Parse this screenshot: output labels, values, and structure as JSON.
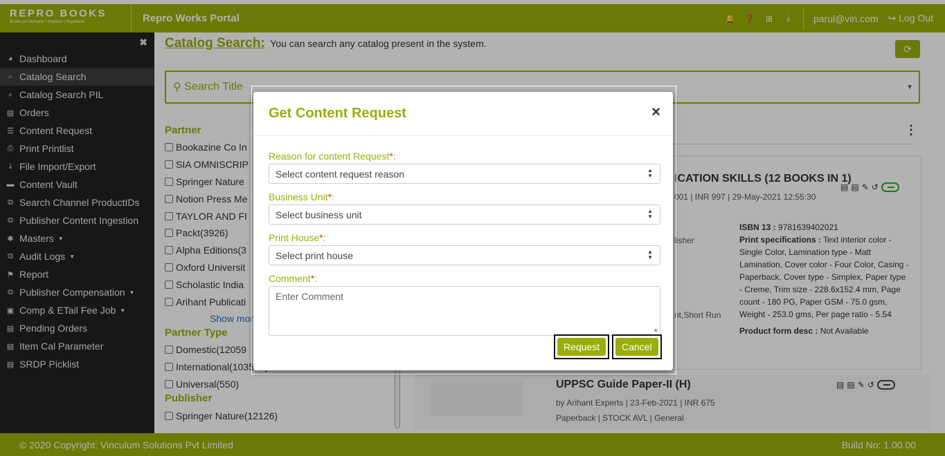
{
  "header": {
    "logo": "REPRO BOOKS",
    "logo_tagline": "Books on Demand • Anytime • Anywhere",
    "portal_title": "Repro Works Portal",
    "icons": [
      "bell-icon",
      "help-icon",
      "plus-square-icon",
      "download-icon"
    ],
    "user_email": "parul@vin.com",
    "logout_label": "Log Out"
  },
  "sidebar": {
    "items": [
      {
        "label": "Dashboard",
        "icon": "◕"
      },
      {
        "label": "Catalog Search",
        "icon": "⌕"
      },
      {
        "label": "Catalog Search PIL",
        "icon": "⌕"
      },
      {
        "label": "Orders",
        "icon": "▤"
      },
      {
        "label": "Content Request",
        "icon": "☰"
      },
      {
        "label": "Print Printlist",
        "icon": "⎙"
      },
      {
        "label": "File Import/Export",
        "icon": "⤓"
      },
      {
        "label": "Content Vault",
        "icon": "▬"
      },
      {
        "label": "Search Channel ProductIDs",
        "icon": "⧉"
      },
      {
        "label": "Publisher Content Ingestion",
        "icon": "⧉"
      },
      {
        "label": "Masters",
        "icon": "✱"
      },
      {
        "label": "Audit Logs",
        "icon": "⧉"
      },
      {
        "label": "Report",
        "icon": "⚑"
      },
      {
        "label": "Publisher Compensation",
        "icon": "⧉"
      },
      {
        "label": "Comp & ETail Fee Job",
        "icon": "▣"
      },
      {
        "label": "Pending Orders",
        "icon": "▤"
      },
      {
        "label": "Item Cal Parameter",
        "icon": "▤"
      },
      {
        "label": "SRDP Picklist",
        "icon": "▤"
      }
    ]
  },
  "catalog": {
    "title": "Catalog Search:",
    "subtitle": "You can search any catalog present in the system.",
    "search_placeholder": "Search Title"
  },
  "facets": {
    "partner_heading": "Partner",
    "partners": [
      "Bookazine Co In",
      "SIA OMNISCRIP",
      "Springer Nature",
      "Notion Press Me",
      "TAYLOR AND FI",
      "Packt(3926)",
      "Alpha Editions(3",
      "Oxford Universit",
      "Scholastic India",
      "Arihant Publicati"
    ],
    "show_more": "Show more",
    "partner_type_heading": "Partner Type",
    "partner_types": [
      "Domestic(12059",
      "International(103592)",
      "Universal(550)"
    ],
    "publisher_heading": "Publisher",
    "publishers": [
      "Springer Nature(12126)"
    ]
  },
  "results": {
    "card1": {
      "title": "ICATION SKILLS (12 BOOKS IN 1)",
      "meta": "001 | INR 997 | 29-May-2021 12:55:30",
      "publisher_frag": "lisher",
      "shortrun_frag": "nt,Short Run",
      "isbn_label": "ISBN 13 :",
      "isbn": "9781639402021",
      "spec_label": "Print specifications :",
      "spec": "Text interior color - Single Color, Lamination type - Matt Lamination, Cover color - Four Color, Casing - Paperback, Cover type - Simplex, Paper type - Creme, Trim size - 228.6x152.4 mm, Page count - 180 PG, Paper GSM - 75.0 gsm, Weight - 253.0 gms, Per page ratio - 5.54",
      "form_label": "Product form desc :",
      "form": "Not Available"
    },
    "card2": {
      "title": "UPPSC Guide Paper-II (H)",
      "meta": "by Arihant Experts | 23-Feb-2021 | INR 675",
      "bar": "Paperback | STOCK AVL | General"
    }
  },
  "footer": {
    "copyright": "© 2020 Copyright: Vinculum Solutions Pvt Limited",
    "build": "Build No: 1.00.00"
  },
  "modal": {
    "title": "Get Content Request",
    "reason_label": "Reason for content Request",
    "reason_placeholder": "Select content request reason",
    "bu_label": "Business Unit",
    "bu_placeholder": "Select business unit",
    "ph_label": "Print House",
    "ph_placeholder": "Select print house",
    "comment_label": "Comment",
    "comment_placeholder": "Enter Comment",
    "required_mark": "*",
    "label_suffix": ":",
    "request_label": "Request",
    "cancel_label": "Cancel"
  },
  "colors": {
    "accent": "#9aae09",
    "sidebar": "#222222",
    "required": "#dd3333"
  }
}
